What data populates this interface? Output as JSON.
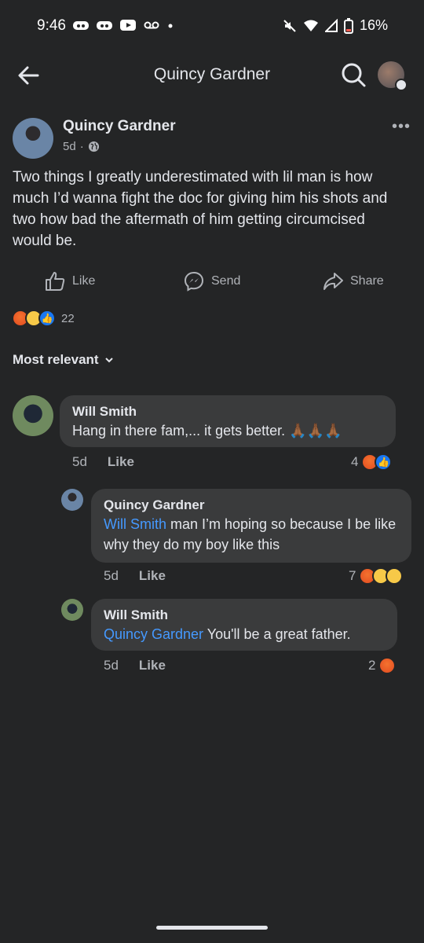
{
  "status_bar": {
    "time": "9:46",
    "battery": "16%"
  },
  "app_bar": {
    "title": "Quincy Gardner"
  },
  "post": {
    "author": "Quincy Gardner",
    "age": "5d",
    "separator": "·",
    "text": "Two things I greatly underestimated with lil man is how much I’d wanna fight the doc for giving him his shots and two how bad the aftermath of him getting circumcised would be.",
    "reaction_count": "22"
  },
  "actions": {
    "like": "Like",
    "send": "Send",
    "share": "Share"
  },
  "sort_label": "Most relevant",
  "comments": [
    {
      "author": "Will Smith",
      "mention": "",
      "text": "Hang in there fam,... it gets better. 🙏🏾🙏🏾🙏🏾",
      "age": "5d",
      "like": "Like",
      "reaction_count": "4"
    },
    {
      "author": "Quincy Gardner",
      "mention": "Will Smith",
      "text": " man I’m hoping so because I be like why they do my boy like this",
      "age": "5d",
      "like": "Like",
      "reaction_count": "7"
    },
    {
      "author": "Will Smith",
      "mention": "Quincy Gardner",
      "text": " You'll be a great father.",
      "age": "5d",
      "like": "Like",
      "reaction_count": "2"
    }
  ],
  "colors": {
    "background": "#242526",
    "bubble": "#3a3b3c",
    "mention": "#4599ff",
    "like_blue": "#1877f2"
  }
}
